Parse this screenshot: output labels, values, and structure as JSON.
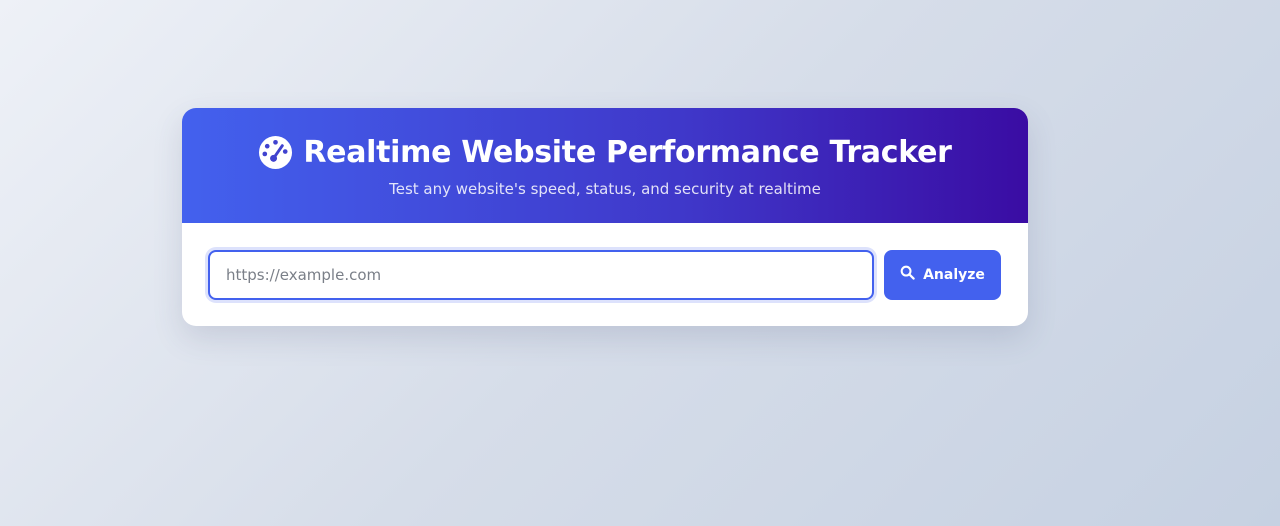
{
  "header": {
    "icon": "gauge-icon",
    "title": "Realtime Website Performance Tracker",
    "subtitle": "Test any website's speed, status, and security at realtime"
  },
  "form": {
    "url_placeholder": "https://example.com",
    "url_value": "",
    "analyze_icon": "search-icon",
    "analyze_label": "Analyze"
  },
  "colors": {
    "accent": "#4361ee",
    "header_gradient_start": "#4361ee",
    "header_gradient_end": "#3a0ca3"
  }
}
